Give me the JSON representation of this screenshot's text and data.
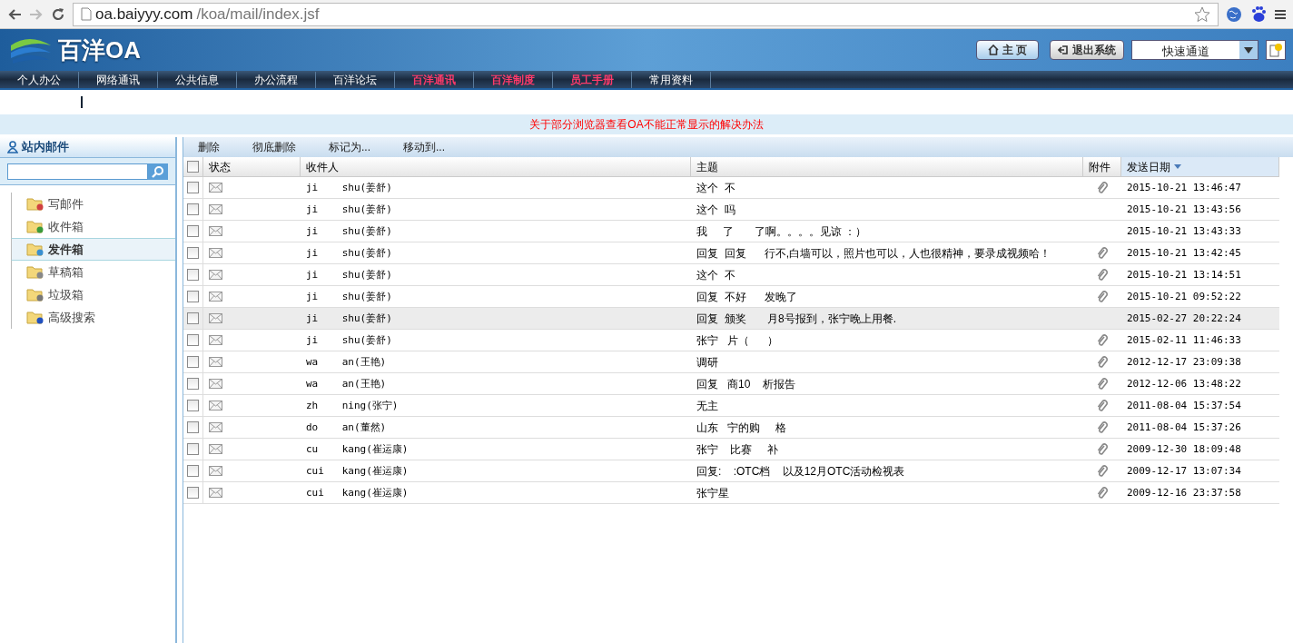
{
  "browser": {
    "url_host": "oa.baiyyy.com",
    "url_path": "/koa/mail/index.jsf"
  },
  "header": {
    "logo": "百洋OA",
    "home": "主 页",
    "logout": "退出系统",
    "quick": "快速通道"
  },
  "nav": [
    {
      "label": "个人办公",
      "highlighted": false
    },
    {
      "label": "网络通讯",
      "highlighted": false
    },
    {
      "label": "公共信息",
      "highlighted": false
    },
    {
      "label": "办公流程",
      "highlighted": false
    },
    {
      "label": "百洋论坛",
      "highlighted": false
    },
    {
      "label": "百洋通讯",
      "highlighted": true
    },
    {
      "label": "百洋制度",
      "highlighted": true
    },
    {
      "label": "员工手册",
      "highlighted": true
    },
    {
      "label": "常用资料",
      "highlighted": false
    }
  ],
  "notice": "关于部分浏览器查看OA不能正常显示的解决办法",
  "sidebar": {
    "title": "站内邮件",
    "items": [
      {
        "label": "写邮件",
        "selected": false
      },
      {
        "label": "收件箱",
        "selected": false
      },
      {
        "label": "发件箱",
        "selected": true
      },
      {
        "label": "草稿箱",
        "selected": false
      },
      {
        "label": "垃圾箱",
        "selected": false
      },
      {
        "label": "高级搜索",
        "selected": false
      }
    ]
  },
  "toolbar": [
    "删除",
    "彻底删除",
    "标记为...",
    "移动到..."
  ],
  "table": {
    "select_all_checked": false,
    "columns": [
      "状态",
      "收件人",
      "主题",
      "附件",
      "发送日期"
    ],
    "rows": [
      {
        "recipient": "ji    shu(姜舒)",
        "subject": "这个  不",
        "attachment": true,
        "date": "2015-10-21 13:46:47",
        "checked": false,
        "selected": false
      },
      {
        "recipient": "ji    shu(姜舒)",
        "subject": "这个  吗",
        "attachment": false,
        "date": "2015-10-21 13:43:56",
        "checked": false,
        "selected": false
      },
      {
        "recipient": "ji    shu(姜舒)",
        "subject": "我     了       了啊。。。。见谅 ：）",
        "attachment": false,
        "date": "2015-10-21 13:43:33",
        "checked": false,
        "selected": false
      },
      {
        "recipient": "ji    shu(姜舒)",
        "subject": "回复  回复      行不,白墙可以，照片也可以，人也很精神，要录成视频哈！",
        "attachment": true,
        "date": "2015-10-21 13:42:45",
        "checked": false,
        "selected": false
      },
      {
        "recipient": "ji    shu(姜舒)",
        "subject": "这个  不",
        "attachment": true,
        "date": "2015-10-21 13:14:51",
        "checked": false,
        "selected": false
      },
      {
        "recipient": "ji    shu(姜舒)",
        "subject": "回复  不好      发晚了",
        "attachment": true,
        "date": "2015-10-21 09:52:22",
        "checked": false,
        "selected": false
      },
      {
        "recipient": "ji    shu(姜舒)",
        "subject": "回复  颁奖       月8号报到，张宁晚上用餐.",
        "attachment": false,
        "date": "2015-02-27 20:22:24",
        "checked": false,
        "selected": true
      },
      {
        "recipient": "ji    shu(姜舒)",
        "subject": "张宁   片（      ）",
        "attachment": true,
        "date": "2015-02-11 11:46:33",
        "checked": false,
        "selected": false
      },
      {
        "recipient": "wa    an(王艳)",
        "subject": "调研",
        "attachment": true,
        "date": "2012-12-17 23:09:38",
        "checked": false,
        "selected": false
      },
      {
        "recipient": "wa    an(王艳)",
        "subject": "回复   商10    析报告",
        "attachment": true,
        "date": "2012-12-06 13:48:22",
        "checked": false,
        "selected": false
      },
      {
        "recipient": "zh    ning(张宁)",
        "subject": "无主",
        "attachment": true,
        "date": "2011-08-04 15:37:54",
        "checked": false,
        "selected": false
      },
      {
        "recipient": "do    an(董然)",
        "subject": "山东   宁的购     格",
        "attachment": true,
        "date": "2011-08-04 15:37:26",
        "checked": false,
        "selected": false
      },
      {
        "recipient": "cu    kang(崔运康)",
        "subject": "张宁    比赛     补",
        "attachment": true,
        "date": "2009-12-30 18:09:48",
        "checked": false,
        "selected": false
      },
      {
        "recipient": "cui   kang(崔运康)",
        "subject": "回复:    :OTC档    以及12月OTC活动检视表",
        "attachment": true,
        "date": "2009-12-17 13:07:34",
        "checked": false,
        "selected": false
      },
      {
        "recipient": "cui   kang(崔运康)",
        "subject": "张宁星",
        "attachment": true,
        "date": "2009-12-16 23:37:58",
        "checked": false,
        "selected": false
      }
    ]
  }
}
